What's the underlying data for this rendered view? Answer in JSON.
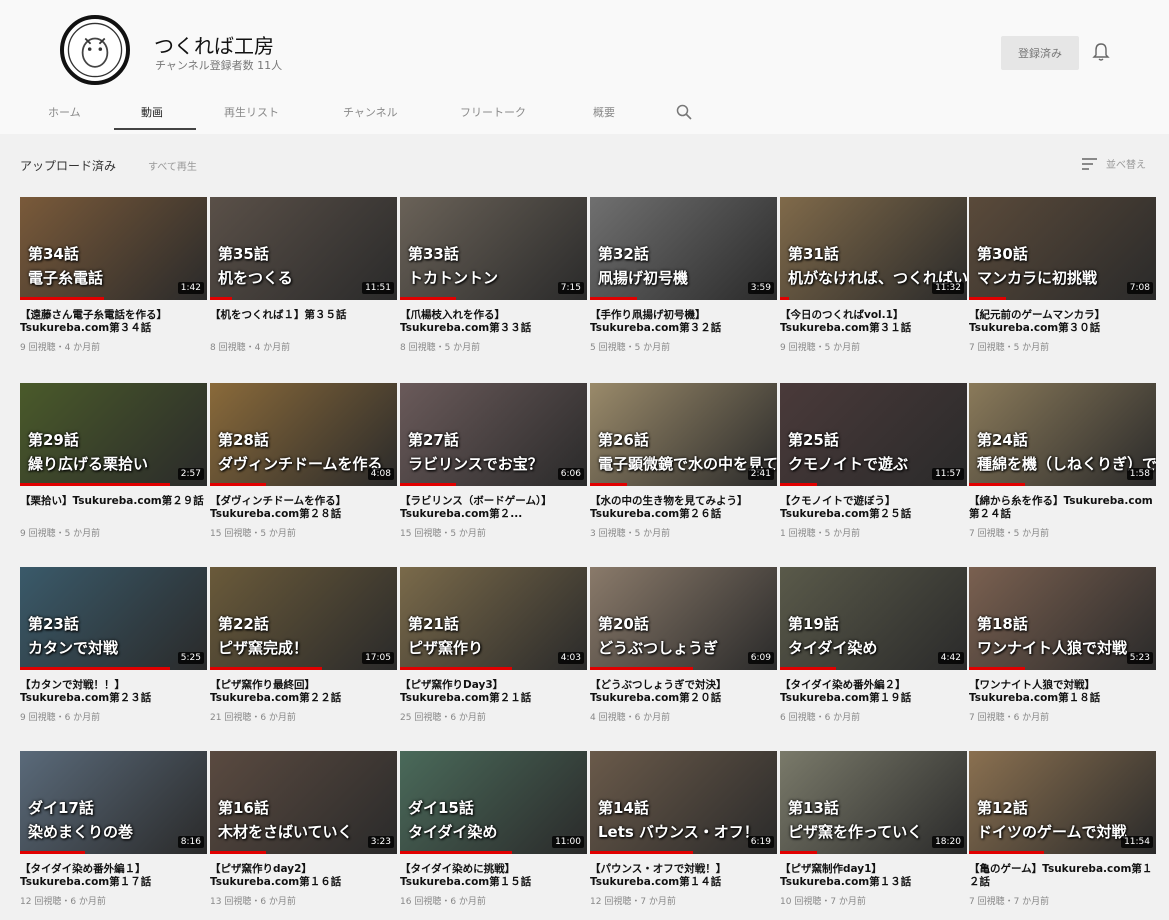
{
  "channel": {
    "name": "つくれば工房",
    "subscribers": "チャンネル登録者数 11人",
    "subscribe_label": "登録済み"
  },
  "tabs": [
    "ホーム",
    "動画",
    "再生リスト",
    "チャンネル",
    "フリートーク",
    "概要"
  ],
  "section": {
    "title": "アップロード済み",
    "play_all": "すべて再生",
    "sort": "並べ替え"
  },
  "videos": [
    {
      "title": "【遠藤さん電子糸電話を作る】Tsukureba.com第３４話",
      "meta": "9 回視聴・4 か月前",
      "duration": "1:42",
      "overlay1": "第34話",
      "overlay2": "電子糸電話",
      "color": "#7a5a3a"
    },
    {
      "title": "【机をつくれば１】第３５話",
      "meta": "8 回視聴・4 か月前",
      "duration": "11:51",
      "overlay1": "第35話",
      "overlay2": "机をつくる",
      "color": "#5a5048"
    },
    {
      "title": "【爪楊枝入れを作る】Tsukureba.com第３３話",
      "meta": "8 回視聴・5 か月前",
      "duration": "7:15",
      "overlay1": "第33話",
      "overlay2": "トカトントン",
      "color": "#6a6258"
    },
    {
      "title": "【手作り凧揚げ初号機】Tsukureba.com第３２話",
      "meta": "5 回視聴・5 か月前",
      "duration": "3:59",
      "overlay1": "第32話",
      "overlay2": "凧揚げ初号機",
      "color": "#707070"
    },
    {
      "title": "【今日のつくればvol.1】Tsukureba.com第３１話",
      "meta": "9 回視聴・5 か月前",
      "duration": "11:32",
      "overlay1": "第31話",
      "overlay2": "机がなければ、つくればいいじゃない",
      "color": "#806a4a"
    },
    {
      "title": "【紀元前のゲームマンカラ】Tsukureba.com第３０話",
      "meta": "7 回視聴・5 か月前",
      "duration": "7:08",
      "overlay1": "第30話",
      "overlay2": "マンカラに初挑戦",
      "color": "#5a4a3a"
    },
    {
      "title": "【栗拾い】Tsukureba.com第２９話",
      "meta": "9 回視聴・5 か月前",
      "duration": "2:57",
      "overlay1": "第29話",
      "overlay2": "繰り広げる栗拾い",
      "color": "#4a5a2a"
    },
    {
      "title": "【ダヴィンチドームを作る】Tsukureba.com第２８話",
      "meta": "15 回視聴・5 か月前",
      "duration": "4:08",
      "overlay1": "第28話",
      "overlay2": "ダヴィンチドームを作る",
      "color": "#8a6a3a"
    },
    {
      "title": "【ラビリンス（ボードゲーム）】Tsukureba.com第２...",
      "meta": "15 回視聴・5 か月前",
      "duration": "6:06",
      "overlay1": "第27話",
      "overlay2": "ラビリンスでお宝？",
      "color": "#6a5a5a"
    },
    {
      "title": "【水の中の生き物を見てみよう】Tsukureba.com第２６話",
      "meta": "3 回視聴・5 か月前",
      "duration": "2:41",
      "overlay1": "第26話",
      "overlay2": "電子顕微鏡で水の中を見てみる",
      "color": "#9a8a6a"
    },
    {
      "title": "【クモノイトで遊ぼう】Tsukureba.com第２５話",
      "meta": "1 回視聴・5 か月前",
      "duration": "11:57",
      "overlay1": "第25話",
      "overlay2": "クモノイトで遊ぶ",
      "color": "#4a3a3a"
    },
    {
      "title": "【綿から糸を作る】Tsukureba.com第２４話",
      "meta": "7 回視聴・5 か月前",
      "duration": "1:58",
      "overlay1": "第24話",
      "overlay2": "種綿を機（しねくりぎ）で種を取る",
      "color": "#8a7a5a"
    },
    {
      "title": "【カタンで対戦！！】Tsukureba.com第２３話",
      "meta": "9 回視聴・6 か月前",
      "duration": "5:25",
      "overlay1": "第23話",
      "overlay2": "カタンで対戦",
      "color": "#3a5a6a"
    },
    {
      "title": "【ピザ窯作り最終回】Tsukureba.com第２２話",
      "meta": "21 回視聴・6 か月前",
      "duration": "17:05",
      "overlay1": "第22話",
      "overlay2": "ピザ窯完成！",
      "color": "#6a5a3a"
    },
    {
      "title": "【ピザ窯作りDay3】Tsukureba.com第２１話",
      "meta": "25 回視聴・6 か月前",
      "duration": "4:03",
      "overlay1": "第21話",
      "overlay2": "ピザ窯作り",
      "color": "#7a6a4a"
    },
    {
      "title": "【どうぶつしょうぎで対決】Tsukureba.com第２０話",
      "meta": "4 回視聴・6 か月前",
      "duration": "6:09",
      "overlay1": "第20話",
      "overlay2": "どうぶつしょうぎ",
      "color": "#8a7a6a"
    },
    {
      "title": "【タイダイ染め番外編２】Tsukureba.com第１９話",
      "meta": "6 回視聴・6 か月前",
      "duration": "4:42",
      "overlay1": "第19話",
      "overlay2": "タイダイ染め",
      "color": "#5a5a4a"
    },
    {
      "title": "【ワンナイト人狼で対戦】Tsukureba.com第１８話",
      "meta": "7 回視聴・6 か月前",
      "duration": "5:23",
      "overlay1": "第18話",
      "overlay2": "ワンナイト人狼で対戦",
      "color": "#7a6050"
    },
    {
      "title": "【タイダイ染め番外編１】Tsukureba.com第１７話",
      "meta": "12 回視聴・6 か月前",
      "duration": "8:16",
      "overlay1": "ダイ17話",
      "overlay2": "染めまくりの巻",
      "color": "#5a6a7a"
    },
    {
      "title": "【ピザ窯作りday2】Tsukureba.com第１６話",
      "meta": "13 回視聴・6 か月前",
      "duration": "3:23",
      "overlay1": "第16話",
      "overlay2": "木材をさばいていく",
      "color": "#5a4a40"
    },
    {
      "title": "【タイダイ染めに挑戦】Tsukureba.com第１５話",
      "meta": "16 回視聴・6 か月前",
      "duration": "11:00",
      "overlay1": "ダイ15話",
      "overlay2": "タイダイ染め",
      "color": "#4a6a5a"
    },
    {
      "title": "【パウンス・オフで対戦！】Tsukureba.com第１４話",
      "meta": "12 回視聴・7 か月前",
      "duration": "6:19",
      "overlay1": "第14話",
      "overlay2": "Lets バウンス・オフ！",
      "color": "#6a5a4a"
    },
    {
      "title": "【ピザ窯制作day1】Tsukureba.com第１３話",
      "meta": "10 回視聴・7 か月前",
      "duration": "18:20",
      "overlay1": "第13話",
      "overlay2": "ピザ窯を作っていく",
      "color": "#7a7a6a"
    },
    {
      "title": "【亀のゲーム】Tsukureba.com第１２話",
      "meta": "7 回視聴・7 か月前",
      "duration": "11:54",
      "overlay1": "第12話",
      "overlay2": "ドイツのゲームで対戦",
      "color": "#8a7050"
    }
  ],
  "colors": {
    "progress": "#e00000",
    "overlay_text": "#ffffff"
  },
  "icons": [
    "bell-icon",
    "search-icon",
    "sort-icon",
    "avatar-logo"
  ]
}
